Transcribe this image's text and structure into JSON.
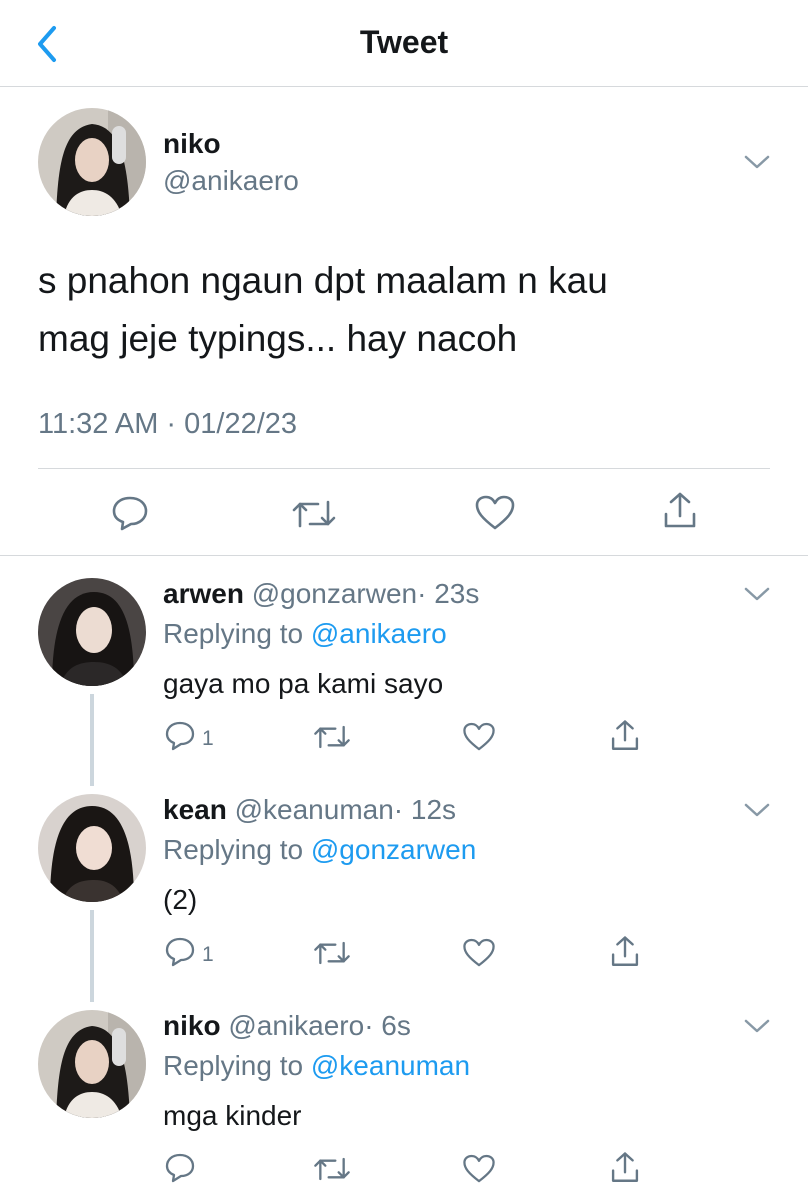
{
  "header": {
    "title": "Tweet"
  },
  "tweet": {
    "name": "niko",
    "handle": "@anikaero",
    "text_line1": "s pnahon ngaun dpt maalam n kau",
    "text_line2": "mag jeje typings... hay nacoh",
    "timestamp": "11:32 AM · 01/22/23"
  },
  "replies": [
    {
      "name": "arwen",
      "handle": "@gonzarwen",
      "age": "· 23s",
      "replying_prefix": "Replying to",
      "replying_to": "@anikaero",
      "text": "gaya mo pa kami sayo",
      "reply_count": "1"
    },
    {
      "name": "kean",
      "handle": "@keanuman",
      "age": "· 12s",
      "replying_prefix": "Replying to",
      "replying_to": "@gonzarwen",
      "text": "(2)",
      "reply_count": "1"
    },
    {
      "name": "niko",
      "handle": "@anikaero",
      "age": "· 6s",
      "replying_prefix": "Replying to",
      "replying_to": "@keanuman",
      "text": "mga kinder",
      "reply_count": ""
    }
  ],
  "colors": {
    "accent": "#1d9bf0",
    "muted": "#657786",
    "divider": "#d6d9dc"
  }
}
